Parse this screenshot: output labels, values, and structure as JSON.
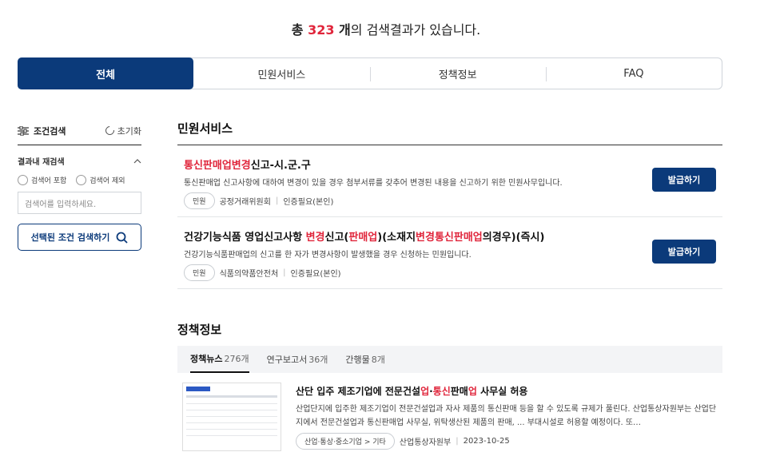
{
  "summary": {
    "prefix": "총 ",
    "count": "323",
    "unit": " 개",
    "suffix": "의 검색결과가 있습니다."
  },
  "tabs": [
    {
      "label": "전체",
      "active": true
    },
    {
      "label": "민원서비스"
    },
    {
      "label": "정책정보"
    },
    {
      "label": "FAQ"
    }
  ],
  "sidebar": {
    "title": "조건검색",
    "reset": "초기화",
    "refine_title": "결과내 재검색",
    "include": "검색어 포함",
    "exclude": "검색어 제외",
    "input_placeholder": "검색어를 입력하세요.",
    "search_button": "선택된 조건 검색하기"
  },
  "civil": {
    "section_title": "민원서비스",
    "items": [
      {
        "title_parts": [
          {
            "text": "통신판매업변경",
            "hl": true
          },
          {
            "text": "신고-시.군.구",
            "hl": false
          }
        ],
        "desc": "통신판매업 신고사항에 대하여 변경이 있을 경우 첨부서류를 갖추어 변경된 내용을 신고하기 위한 민원사무입니다.",
        "tag": "민원",
        "agency": "공정거래위원회",
        "auth": "인증필요(본인)",
        "button": "발급하기"
      },
      {
        "title_parts": [
          {
            "text": "건강기능식품 영업신고사항 ",
            "hl": false
          },
          {
            "text": "변경",
            "hl": true
          },
          {
            "text": "신고(",
            "hl": false
          },
          {
            "text": "판매업",
            "hl": true
          },
          {
            "text": ")(소재지",
            "hl": false
          },
          {
            "text": "변경통신판매업",
            "hl": true
          },
          {
            "text": "의경우)(즉시)",
            "hl": false
          }
        ],
        "desc": "건강기능식품판매업의 신고를 한 자가 변경사항이 발생했을 경우 신청하는 민원입니다.",
        "tag": "민원",
        "agency": "식품의약품안전처",
        "auth": "인증필요(본인)",
        "button": "발급하기"
      }
    ]
  },
  "policy": {
    "section_title": "정책정보",
    "subtabs": [
      {
        "label": "정책뉴스",
        "count": "276개",
        "active": true
      },
      {
        "label": "연구보고서",
        "count": "36개"
      },
      {
        "label": "간행물",
        "count": "8개"
      }
    ],
    "news": {
      "title_parts": [
        {
          "text": "산단 입주 제조기업에 전문건설",
          "hl": false
        },
        {
          "text": "업",
          "hl": true
        },
        {
          "text": "·",
          "hl": false
        },
        {
          "text": "통신",
          "hl": true
        },
        {
          "text": "판매",
          "hl": false
        },
        {
          "text": "업",
          "hl": true
        },
        {
          "text": " 사무실 허용",
          "hl": false
        }
      ],
      "desc": "산업단지에 입주한 제조기업이 전문건설업과 자사 제품의 통신판매 등을 할 수 있도록 규제가 풀린다. 산업통상자원부는 산업단지에서 전문건설업과 통신판매업 사무실, 위탁생산된 제품의 판매, ... 부대시설로 허용할 예정이다. 또…",
      "category": "산업·통상·중소기업 > 기타",
      "agency": "산업통상자원부",
      "date": "2023-10-25"
    }
  },
  "colors": {
    "primary": "#0b3a7a",
    "highlight": "#e0253b"
  }
}
